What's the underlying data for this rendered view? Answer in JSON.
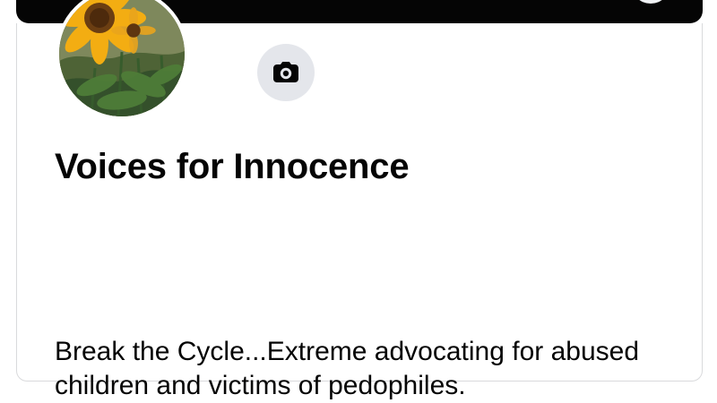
{
  "profile": {
    "name": "Voices for Innocence",
    "bio": "Break the Cycle...Extreme advocating for abused children and victims of pedophiles."
  },
  "icons": {
    "camera": "camera-icon",
    "profile_picture": "sunflower-field-photo"
  },
  "colors": {
    "cover": "#050505",
    "camera_button": "#e4e6eb",
    "text": "#050505",
    "card_border": "#d9dadc"
  }
}
